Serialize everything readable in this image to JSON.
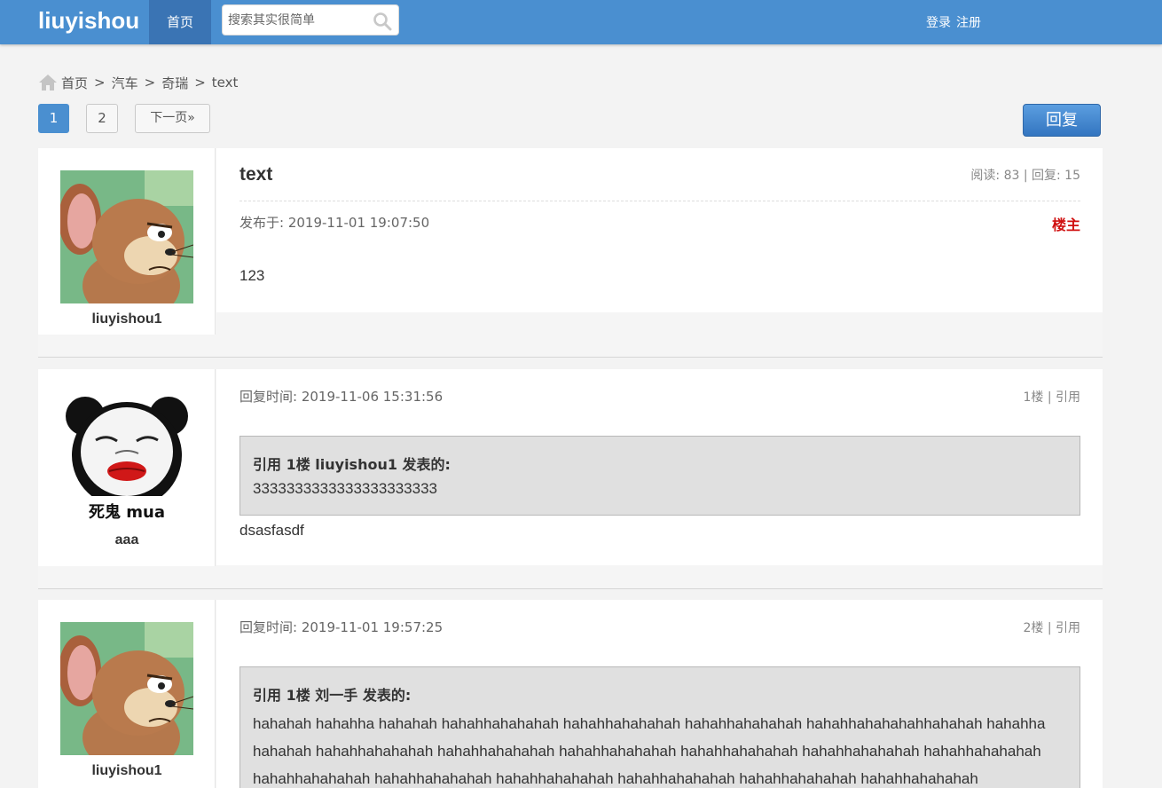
{
  "header": {
    "logo": "liuyishou",
    "nav_home": "首页",
    "search_placeholder": "搜索其实很简单",
    "login": "登录",
    "register": "注册"
  },
  "breadcrumb": [
    "首页",
    "汽车",
    "奇瑞",
    "text"
  ],
  "breadcrumb_sep": ">",
  "pagination": {
    "pages": [
      "1",
      "2"
    ],
    "current": "1",
    "next": "下一页»"
  },
  "reply_button": "回复",
  "topic": {
    "author": "liuyishou1",
    "title": "text",
    "stats": "阅读: 83 | 回复: 15",
    "published": "发布于: 2019-11-01 19:07:50",
    "owner_badge": "楼主",
    "content": "123"
  },
  "replies": [
    {
      "author": "aaa",
      "avatar_caption": "死鬼 mua",
      "time": "回复时间: 2019-11-06 15:31:56",
      "floor_quote": "1楼 | 引用",
      "quote_head": "引用 1楼 liuyishou1 发表的:",
      "quote_body": "3333333333333333333333",
      "content": "dsasfasdf"
    },
    {
      "author": "liuyishou1",
      "time": "回复时间: 2019-11-01 19:57:25",
      "floor_quote": "2楼 | 引用",
      "quote_head": "引用 1楼 刘一手 发表的:",
      "quote_body": "hahahah hahahha hahahah hahahhahahahah hahahhahahahah hahahhahahahah hahahhahahahahhahahah hahahha hahahah hahahhahahahah hahahhahahahah hahahhahahahah hahahhahahahah hahahhahahahah hahahhahahahah hahahhahahahah hahahhahahahah hahahhahahahah hahahhahahahah hahahhahahahah hahahhahahahah"
    }
  ],
  "colors": {
    "topbar": "#4a8fd0",
    "nav_active": "#3a74b4",
    "owner_badge": "#d01010",
    "quote_bg": "#e0e0e0"
  }
}
